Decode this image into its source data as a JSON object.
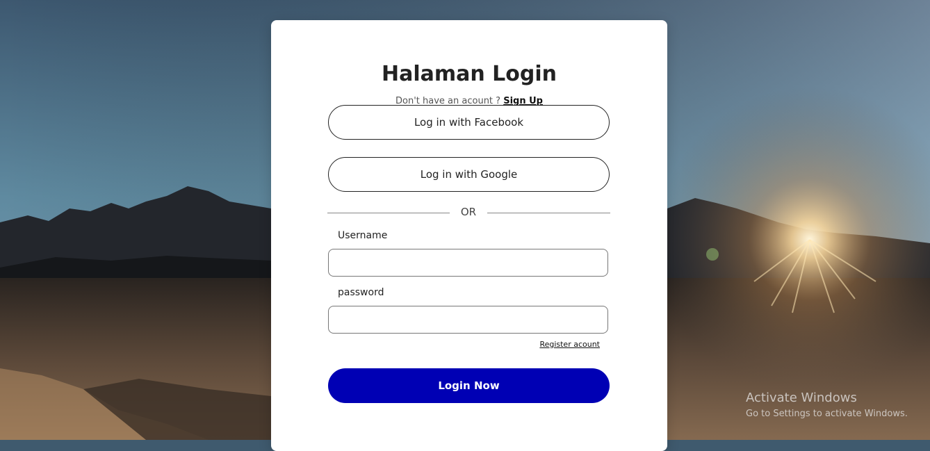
{
  "login": {
    "title": "Halaman Login",
    "subtitle_text": "Don't have an acount ? ",
    "signup_link": "Sign Up",
    "facebook_button": "Log in with Facebook",
    "google_button": "Log in with Google",
    "divider_text": "OR",
    "username_label": "Username",
    "username_value": "",
    "password_label": "password",
    "password_value": "",
    "register_link": "Register acount",
    "submit_button": "Login Now"
  },
  "watermark": {
    "line1": "Activate Windows",
    "line2": "Go to Settings to activate Windows."
  },
  "colors": {
    "primary_button": "#0000b4",
    "card_background": "#ffffff"
  }
}
